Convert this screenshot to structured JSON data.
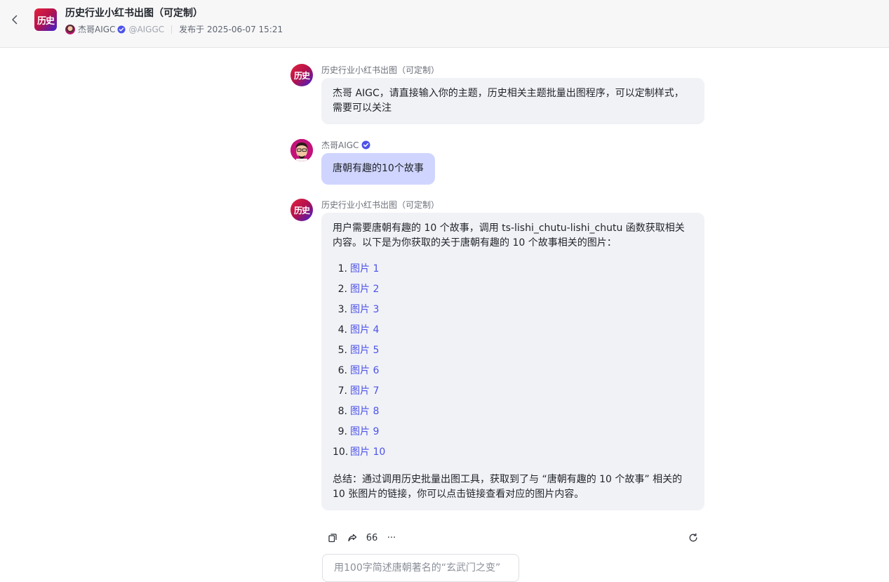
{
  "header": {
    "title": "历史行业小红书出图（可定制）",
    "bot_logo_text": "历史",
    "author": "杰哥AIGC",
    "handle": "@AIGGC",
    "published": "发布于 2025-06-07 15:21"
  },
  "messages": [
    {
      "sender": "历史行业小红书出图（可定制）",
      "avatar_text": "历史",
      "text": "杰哥 AIGC，请直接输入你的主题，历史相关主题批量出图程序，可以定制样式，需要可以关注"
    },
    {
      "sender": "杰哥AIGC",
      "text": "唐朝有趣的10个故事"
    },
    {
      "sender": "历史行业小红书出图（可定制）",
      "avatar_text": "历史",
      "intro": "用户需要唐朝有趣的 10 个故事，调用 ts-lishi_chutu-lishi_chutu 函数获取相关内容。以下是为你获取的关于唐朝有趣的 10 个故事相关的图片：",
      "items": [
        {
          "num": "1.",
          "label": "图片 1"
        },
        {
          "num": "2.",
          "label": "图片 2"
        },
        {
          "num": "3.",
          "label": "图片 3"
        },
        {
          "num": "4.",
          "label": "图片 4"
        },
        {
          "num": "5.",
          "label": "图片 5"
        },
        {
          "num": "6.",
          "label": "图片 6"
        },
        {
          "num": "7.",
          "label": "图片 7"
        },
        {
          "num": "8.",
          "label": "图片 8"
        },
        {
          "num": "9.",
          "label": "图片 9"
        },
        {
          "num": "10.",
          "label": "图片 10"
        }
      ],
      "summary": "总结：通过调用历史批量出图工具，获取到了与 “唐朝有趣的 10 个故事” 相关的 10 张图片的链接，你可以点击链接查看对应的图片内容。"
    }
  ],
  "actions": {
    "copy_icon": "copy-icon",
    "share_icon": "share-icon",
    "quote_label": "66",
    "more_label": "···",
    "regenerate_icon": "refresh-icon"
  },
  "suggestion": "用100字简述唐朝著名的“玄武门之变”",
  "colors": {
    "link": "#4d53e8",
    "user_bubble": "#d0d5ff",
    "bot_bubble": "#f1f2f6",
    "verify": "#4d53e8"
  }
}
